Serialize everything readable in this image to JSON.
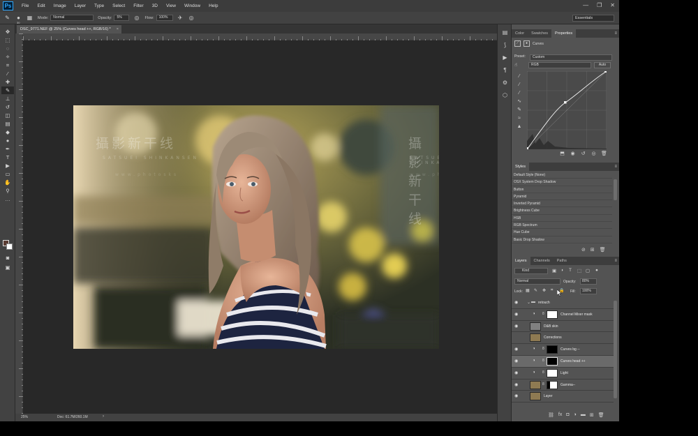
{
  "app": {
    "logo": "Ps",
    "menu": [
      "File",
      "Edit",
      "Image",
      "Layer",
      "Type",
      "Select",
      "Filter",
      "3D",
      "View",
      "Window",
      "Help"
    ],
    "window_controls": [
      "—",
      "❐",
      "✕"
    ]
  },
  "options": {
    "brush_size": "30",
    "mode_label": "Mode:",
    "mode_value": "Normal",
    "opacity_label": "Opacity:",
    "opacity_value": "5%",
    "flow_label": "Flow:",
    "flow_value": "100%",
    "workspace": "Essentials"
  },
  "document": {
    "tab_title": "DSC_9771.NEF @ 25% (Curves head ++, RGB/16) *",
    "tab_close": "×",
    "zoom": "25%",
    "doc_size": "Doc: 61.7M/260.1M"
  },
  "watermark": {
    "cn": "攝影新干线",
    "en": "SATSUEI SHINKANSEN",
    "url": "www.photosks"
  },
  "colors": {
    "fg": "#5a3c32",
    "bg": "#ffffff",
    "accent": "#31a8ff"
  },
  "properties": {
    "tabs": [
      "Color",
      "Swatches",
      "Properties"
    ],
    "title": "Curves",
    "preset_label": "Preset:",
    "preset_value": "Custom",
    "channel_value": "RGB",
    "auto_label": "Auto"
  },
  "styles": {
    "tab": "Styles",
    "items": [
      "Default Style (None)",
      "OSX System Drop Shadow",
      "Button",
      "Pyramid",
      "Inverted Pyramid",
      "Brightness Cube",
      "HSB",
      "RGB Spectrum",
      "Hue Cube",
      "Basic Drop Shadow"
    ]
  },
  "layers": {
    "tabs": [
      "Layers",
      "Channels",
      "Paths"
    ],
    "kind_value": "Kind",
    "blend_value": "Normal",
    "opacity_label": "Opacity:",
    "opacity_value": "80%",
    "lock_label": "Lock:",
    "fill_label": "Fill:",
    "fill_value": "100%",
    "items": [
      {
        "name": "retouch"
      },
      {
        "name": "Channel Mixer mask"
      },
      {
        "name": "D&B skin"
      },
      {
        "name": "Corrections"
      },
      {
        "name": "Curves bg --"
      },
      {
        "name": "Curves head ++"
      },
      {
        "name": "Light"
      },
      {
        "name": "Gamma--"
      },
      {
        "name": "Layer"
      }
    ]
  }
}
